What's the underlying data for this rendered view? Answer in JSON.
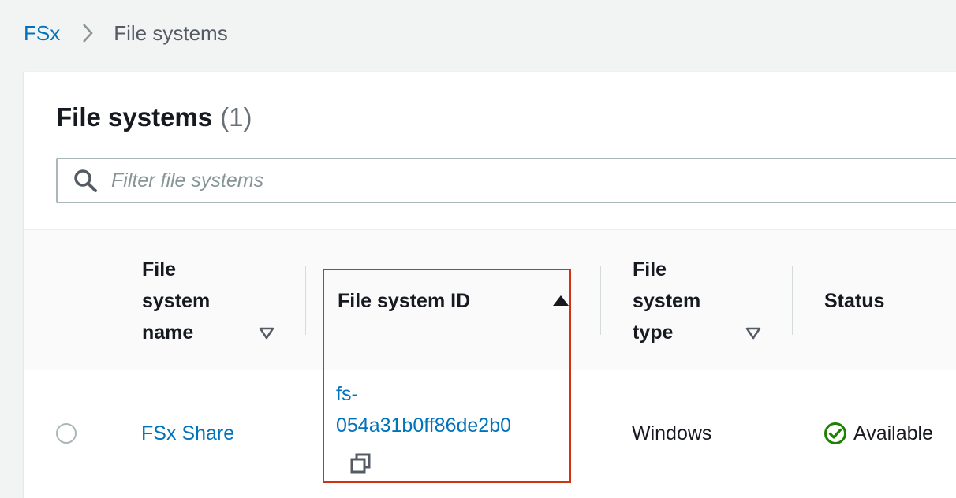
{
  "breadcrumb": {
    "root": "FSx",
    "current": "File systems"
  },
  "panel": {
    "title": "File systems",
    "count": "(1)"
  },
  "filter": {
    "placeholder": "Filter file systems",
    "value": ""
  },
  "table": {
    "columns": [
      {
        "line1": "File",
        "line2": "system",
        "line3": "name",
        "sort": "descending-inactive"
      },
      {
        "label": "File system ID",
        "sort": "ascending-active"
      },
      {
        "line1": "File",
        "line2": "system",
        "line3": "type",
        "sort": "descending-inactive"
      },
      {
        "label": "Status"
      }
    ],
    "rows": [
      {
        "selected": false,
        "name": "FSx Share",
        "id_line1": "fs-",
        "id_line2": "054a31b0ff86de2b0",
        "type": "Windows",
        "status": "Available"
      }
    ]
  },
  "colors": {
    "link": "#0073bb",
    "status_success": "#1d8102",
    "highlight": "#d13212"
  },
  "icons": {
    "breadcrumb_separator": "chevron-right-icon",
    "search": "search-icon",
    "copy": "copy-icon",
    "status": "check-circle-icon",
    "sort_active": "caret-up-filled-icon",
    "sort_inactive": "caret-down-outline-icon"
  }
}
